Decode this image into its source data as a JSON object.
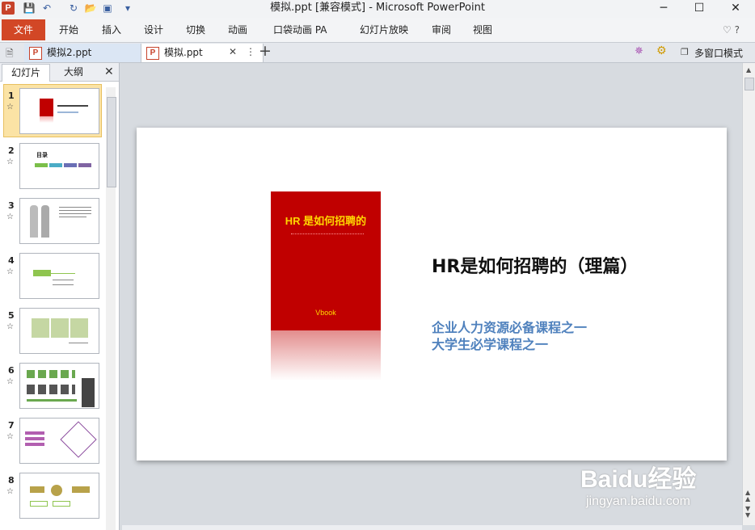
{
  "window": {
    "title": "模拟.ppt [兼容模式] - Microsoft PowerPoint",
    "app_letter": "P",
    "min": "─",
    "max": "☐",
    "close": "✕"
  },
  "ribbon": {
    "file": "文件",
    "tabs": [
      "开始",
      "插入",
      "设计",
      "切换",
      "动画",
      "口袋动画 PA",
      "幻灯片放映",
      "审阅",
      "视图"
    ],
    "help": "♡ ?"
  },
  "doc_tabs": {
    "tab1": "模拟2.ppt",
    "tab2": "模拟.ppt",
    "close": "✕",
    "more": "⋮",
    "add": "+",
    "multi_window": "多窗口模式"
  },
  "panel": {
    "tab_slides": "幻灯片",
    "tab_outline": "大纲",
    "close": "✕",
    "slide_numbers": [
      "1",
      "2",
      "3",
      "4",
      "5",
      "6",
      "7",
      "8"
    ],
    "star": "☆"
  },
  "thumbs": {
    "s2_title": "目录"
  },
  "slide": {
    "book_title": "HR 是如何招聘的",
    "book_brand": "Vbook",
    "title": "HR是如何招聘的（理篇）",
    "sub1": "企业人力资源必备课程之一",
    "sub2": "大学生必学课程之一"
  },
  "watermark": {
    "brand": "Baidu经验",
    "url": "jingyan.baidu.com"
  },
  "colors": {
    "file_tab": "#d24726",
    "book_red": "#c00000",
    "subtitle_blue": "#4f81bd",
    "selection": "#fbe3a5"
  }
}
